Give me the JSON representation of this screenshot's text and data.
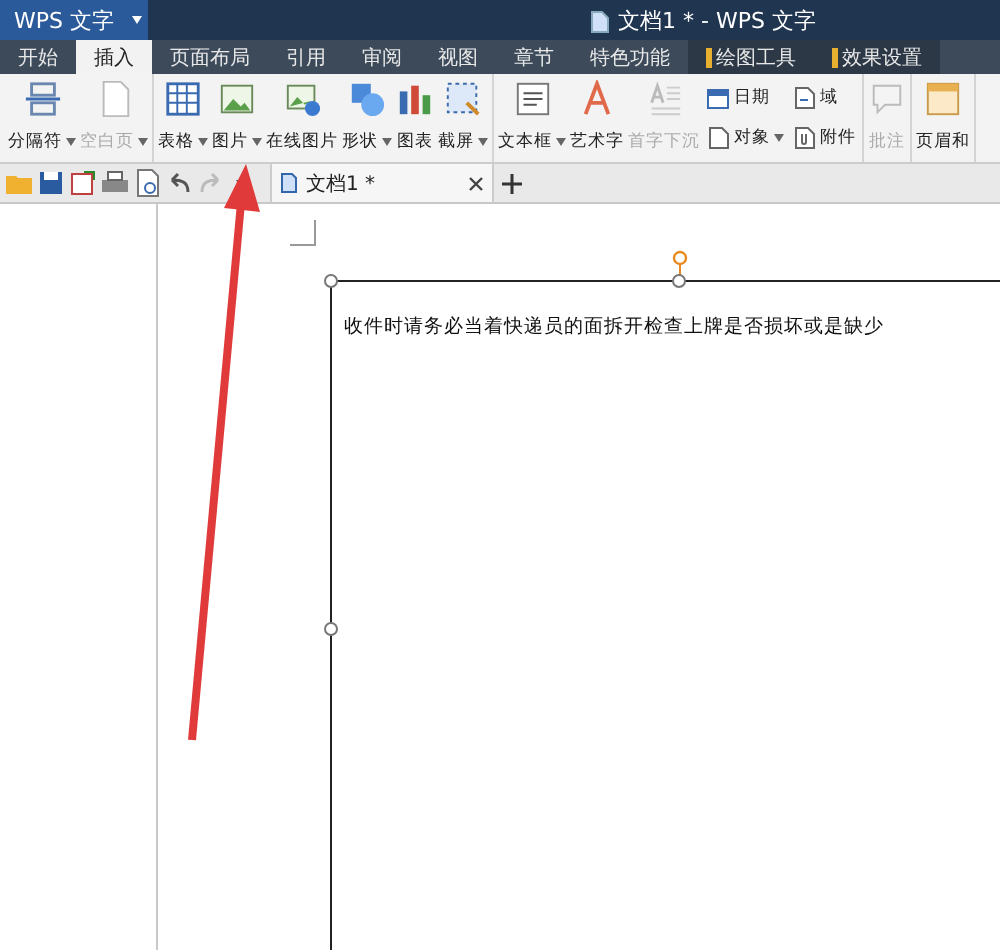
{
  "app_button": {
    "label": "WPS 文字"
  },
  "window": {
    "title": "文档1 * - WPS 文字"
  },
  "tabs": [
    {
      "label": "开始",
      "selected": false,
      "kind": "normal"
    },
    {
      "label": "插入",
      "selected": true,
      "kind": "normal"
    },
    {
      "label": "页面布局",
      "selected": false,
      "kind": "normal"
    },
    {
      "label": "引用",
      "selected": false,
      "kind": "normal"
    },
    {
      "label": "审阅",
      "selected": false,
      "kind": "normal"
    },
    {
      "label": "视图",
      "selected": false,
      "kind": "normal"
    },
    {
      "label": "章节",
      "selected": false,
      "kind": "normal"
    },
    {
      "label": "特色功能",
      "selected": false,
      "kind": "normal"
    },
    {
      "label": "绘图工具",
      "selected": false,
      "kind": "contextual"
    },
    {
      "label": "效果设置",
      "selected": false,
      "kind": "contextual"
    }
  ],
  "ribbon": {
    "groups": [
      {
        "items": [
          {
            "kind": "large",
            "label": "分隔符",
            "dropdown": true,
            "disabled": false
          },
          {
            "kind": "large",
            "label": "空白页",
            "dropdown": true,
            "disabled": true
          }
        ]
      },
      {
        "items": [
          {
            "kind": "large",
            "label": "表格",
            "dropdown": true,
            "disabled": false
          },
          {
            "kind": "large",
            "label": "图片",
            "dropdown": true,
            "disabled": false
          },
          {
            "kind": "large",
            "label": "在线图片",
            "dropdown": false,
            "disabled": false
          },
          {
            "kind": "large",
            "label": "形状",
            "dropdown": true,
            "disabled": false
          },
          {
            "kind": "large",
            "label": "图表",
            "dropdown": false,
            "disabled": false
          },
          {
            "kind": "large",
            "label": "截屏",
            "dropdown": true,
            "disabled": false
          }
        ]
      },
      {
        "items": [
          {
            "kind": "large",
            "label": "文本框",
            "dropdown": true,
            "disabled": false
          },
          {
            "kind": "large",
            "label": "艺术字",
            "dropdown": false,
            "disabled": false
          },
          {
            "kind": "large",
            "label": "首字下沉",
            "dropdown": false,
            "disabled": true
          },
          {
            "kind": "small",
            "top": {
              "label": "日期",
              "dropdown": false
            },
            "bottom": {
              "label": "对象",
              "dropdown": true
            }
          },
          {
            "kind": "small",
            "top": {
              "label": "域",
              "dropdown": false
            },
            "bottom": {
              "label": "附件",
              "dropdown": false
            }
          }
        ]
      },
      {
        "items": [
          {
            "kind": "large",
            "label": "批注",
            "dropdown": false,
            "disabled": true
          }
        ]
      },
      {
        "items": [
          {
            "kind": "large",
            "label": "页眉和",
            "dropdown": false,
            "disabled": false
          }
        ]
      }
    ]
  },
  "document_tab": {
    "label": "文档1 *"
  },
  "document": {
    "text": "收件时请务必当着快递员的面拆开检查上牌是否损坏或是缺少"
  }
}
